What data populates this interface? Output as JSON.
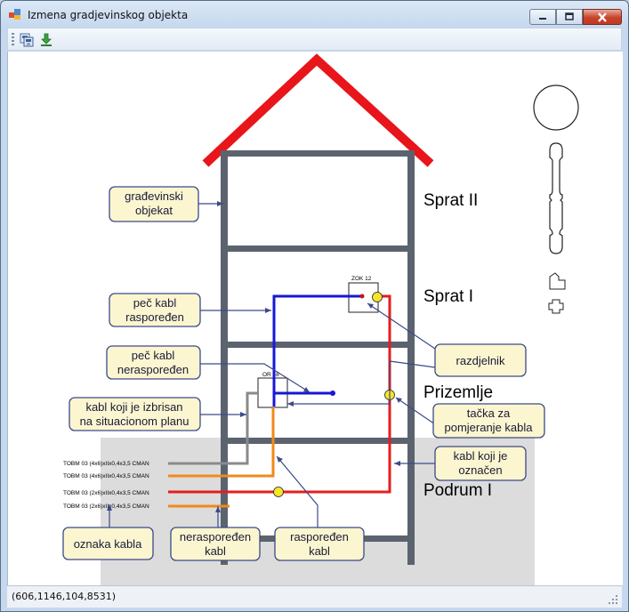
{
  "window": {
    "title": "Izmena gradjevinskog objekta"
  },
  "toolbar": {
    "buttons": [
      {
        "icon": "save-layout-icon"
      },
      {
        "icon": "download-arrow-icon"
      }
    ]
  },
  "floors": {
    "sprat2": "Sprat II",
    "sprat1": "Sprat I",
    "prizemlje": "Prizemlje",
    "podrum": "Podrum I"
  },
  "devices": {
    "zok": "ZOK 12",
    "or": "OR 48"
  },
  "cables": [
    {
      "label": "TOBM 03  (4x6)xIIx0,4x3,5 CMAN",
      "color": "#8a8a8a"
    },
    {
      "label": "TOBM 03  (4x6)xIIx0,4x3,5 CMAN",
      "color": "#f08a1c"
    },
    {
      "label": "TOBM 03  (2x6)xIIx0,4x3,5 CMAN",
      "color": "#e41e1e"
    },
    {
      "label": "TOBM 03  (2x6)xIIx0,4x3,5 CMAN",
      "color": "#f08a1c"
    }
  ],
  "callouts": {
    "gradjevinski_objekat": [
      "građevinski",
      "objekat"
    ],
    "pec_kabl_rasporedjen": [
      "peč kabl",
      "raspoređen"
    ],
    "pec_kabl_nerasporedjen": [
      "peč kabl",
      "neraspoređen"
    ],
    "kabl_izbrisan": [
      "kabl koji je izbrisan",
      "na situacionom planu"
    ],
    "oznaka_kabla": [
      "oznaka kabla"
    ],
    "nerasporedjen_kabl": [
      "neraspoređen",
      "kabl"
    ],
    "rasporedjen_kabl": [
      "raspoređen",
      "kabl"
    ],
    "razdjelnik": [
      "razdjelnik"
    ],
    "tacka_za_pomjeranje": [
      "tačka za",
      "pomjeranje kabla"
    ],
    "kabl_oznacen": [
      "kabl koji je",
      "označen"
    ]
  },
  "colors": {
    "roof": "#e8151b",
    "wall": "#5b636e",
    "basement_fill": "#dcdcdc",
    "callout_fill": "#fbf6cf",
    "callout_border": "#3c4a8a",
    "blue_cable": "#1717d6",
    "red_cable": "#e41e1e",
    "orange_cable": "#f08a1c",
    "gray_cable": "#8a8a8a",
    "handle_point": "#f4e52a"
  },
  "status": {
    "coords": "(606,1146,104,8531)"
  }
}
